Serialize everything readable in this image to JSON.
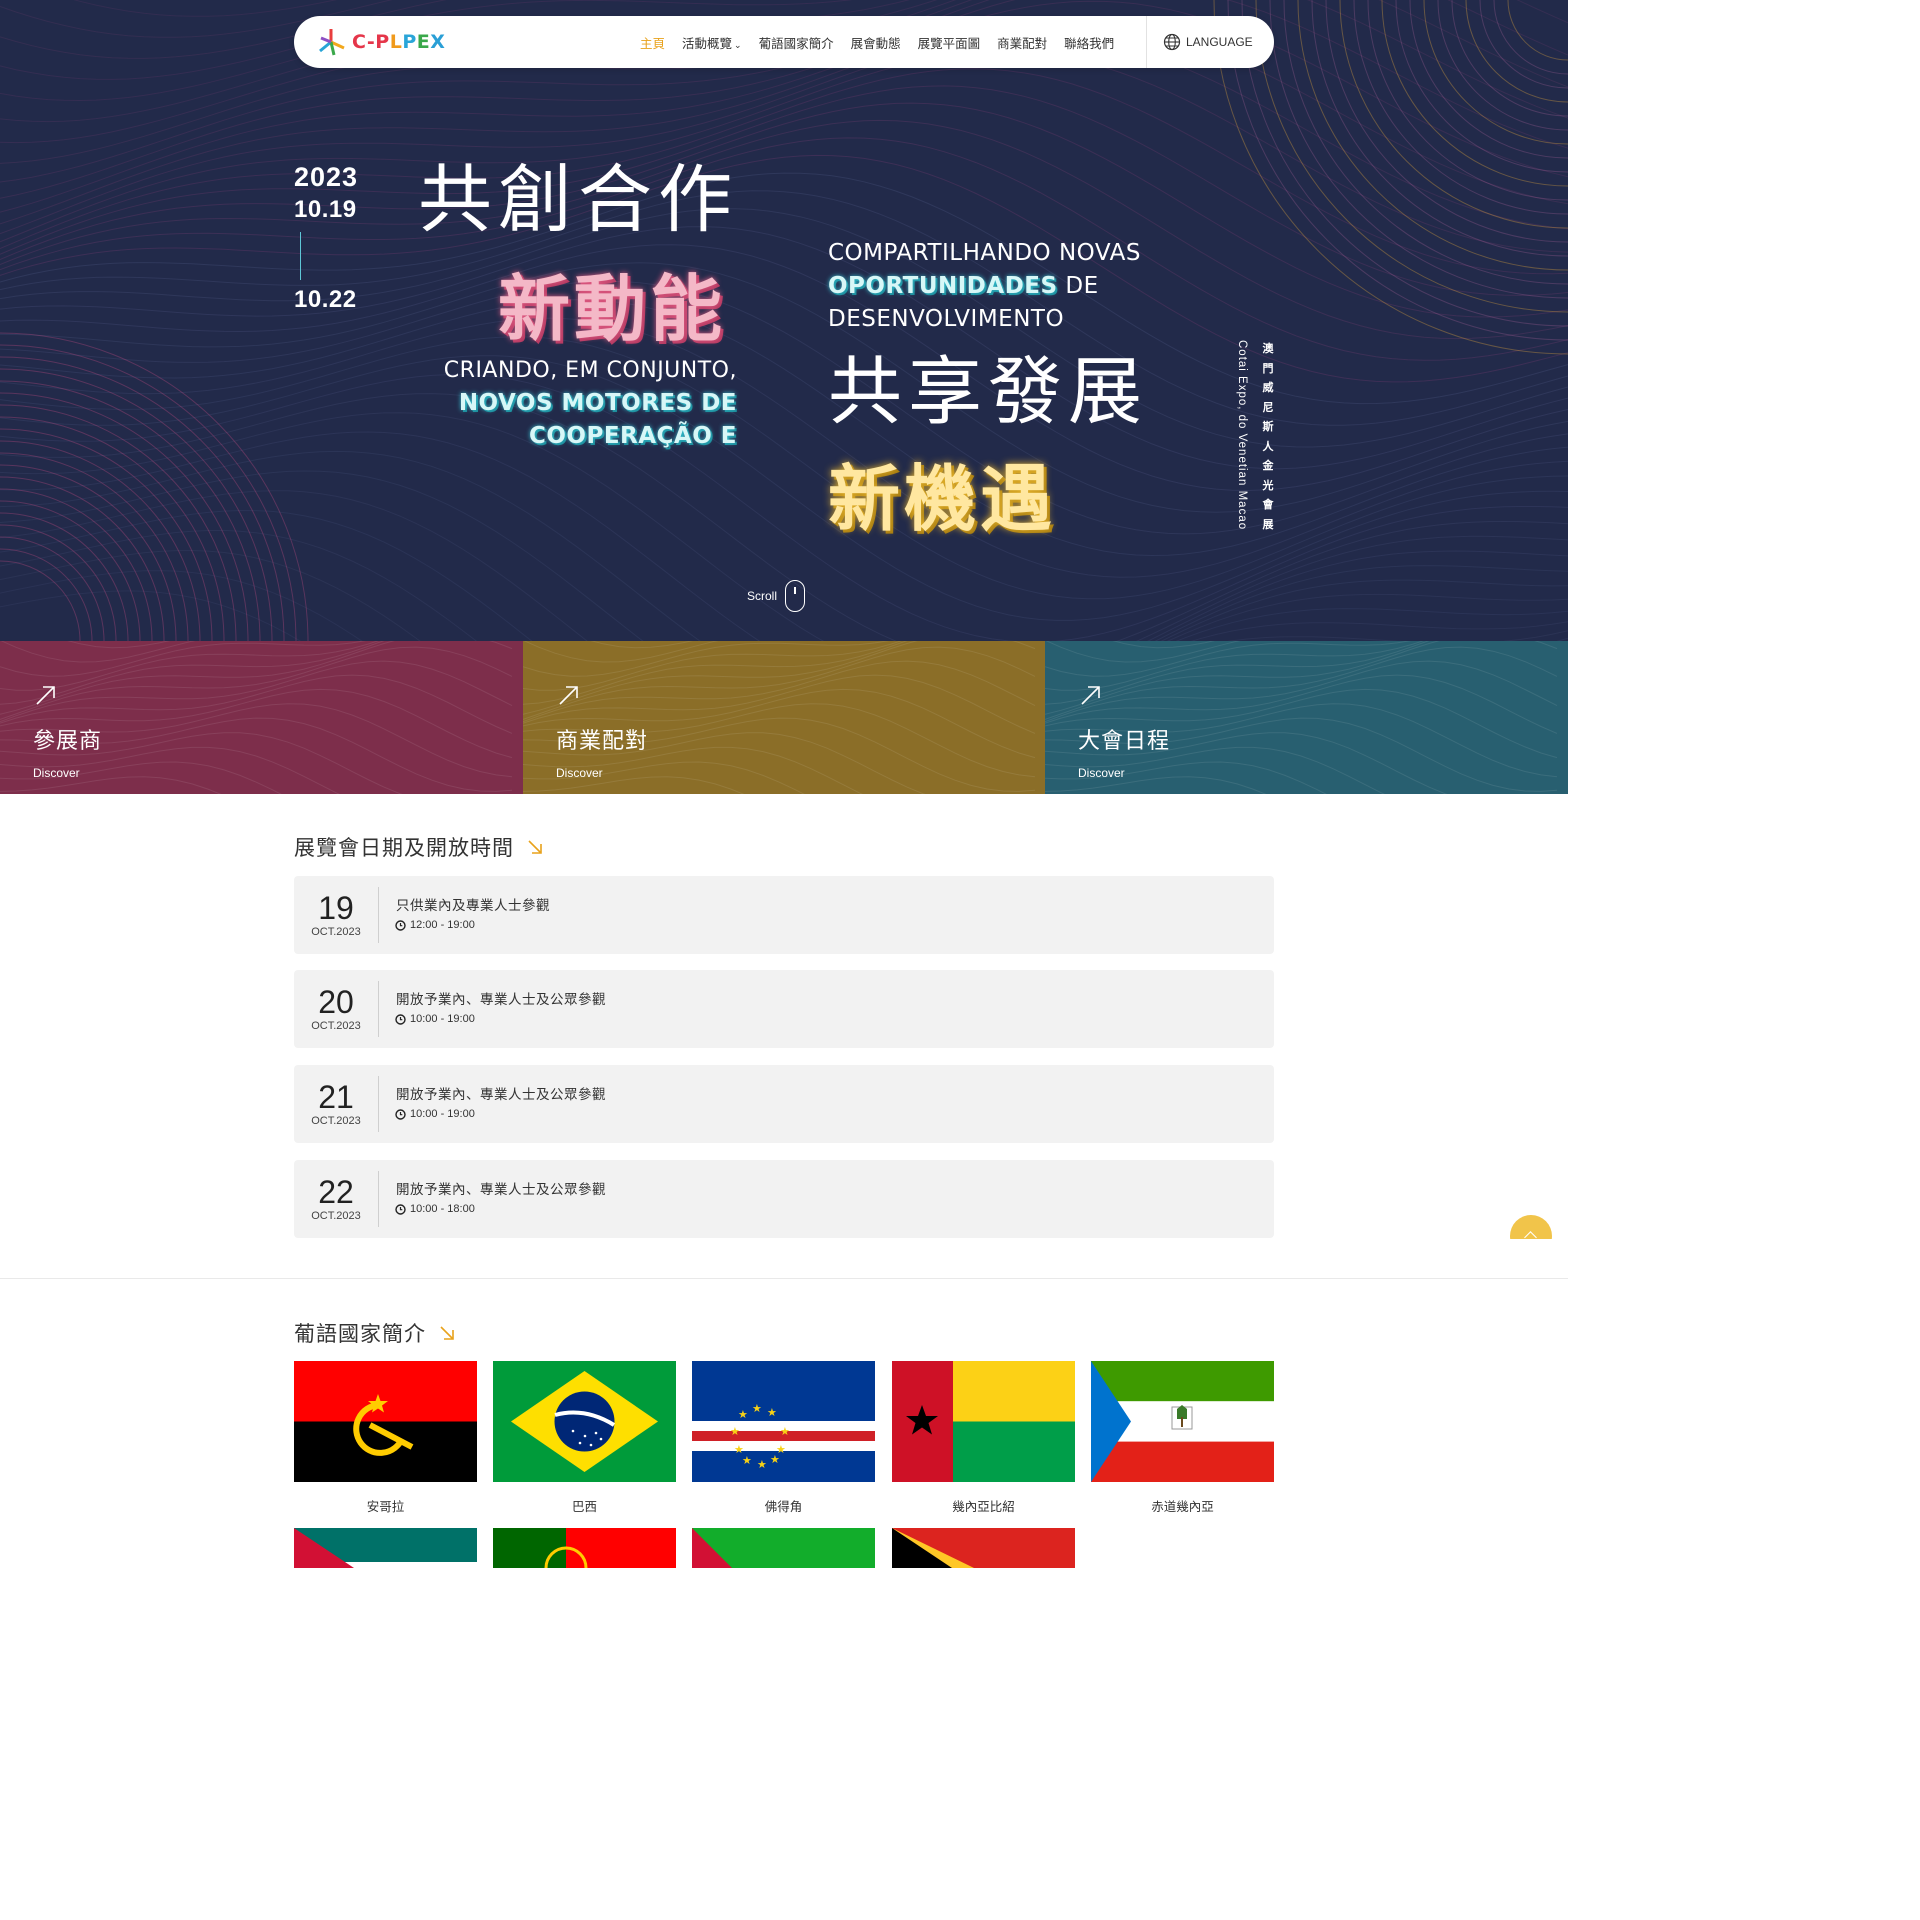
{
  "brand": {
    "logo_text": "C-PLPEX"
  },
  "nav": {
    "items": [
      "主頁",
      "活動概覽",
      "葡語國家簡介",
      "展會動態",
      "展覽平面圖",
      "商業配對",
      "聯絡我們"
    ],
    "language": "LANGUAGE",
    "colors": {
      "active": "#e8a21c",
      "hero_bg": "#222a4a"
    }
  },
  "hero": {
    "year": "2023",
    "date_start": "10.19",
    "date_end": "10.22",
    "cn_line1": "共創合作",
    "cn_line1_highlight": "新動能",
    "pt_left_line1": "CRIANDO, EM CONJUNTO,",
    "pt_left_line2": "NOVOS MOTORES DE",
    "pt_left_line3": "COOPERAÇÃO E",
    "pt_right_line1": "COMPARTILHANDO NOVAS",
    "pt_right_line2a": "OPORTUNIDADES",
    "pt_right_line2b": " DE",
    "pt_right_line3": "DESENVOLVIMENTO",
    "cn_line2": "共享發展",
    "cn_line2_highlight": "新機遇",
    "venue_cn": "澳門威尼斯人金光會展",
    "venue_en": "Cotai Expo, do Venetian Macao",
    "scroll_label": "Scroll"
  },
  "tiles": [
    {
      "title": "參展商",
      "link": "Discover",
      "color": "#7d2e4b"
    },
    {
      "title": "商業配對",
      "link": "Discover",
      "color": "#8b6e28"
    },
    {
      "title": "大會日程",
      "link": "Discover",
      "color": "#285f70"
    }
  ],
  "schedule": {
    "title": "展覽會日期及開放時間",
    "rows": [
      {
        "day": "19",
        "month": "OCT.2023",
        "desc": "只供業內及專業人士參觀",
        "time": "12:00 - 19:00"
      },
      {
        "day": "20",
        "month": "OCT.2023",
        "desc": "開放予業內、專業人士及公眾參觀",
        "time": "10:00 - 19:00"
      },
      {
        "day": "21",
        "month": "OCT.2023",
        "desc": "開放予業內、專業人士及公眾參觀",
        "time": "10:00 - 19:00"
      },
      {
        "day": "22",
        "month": "OCT.2023",
        "desc": "開放予業內、專業人士及公眾參觀",
        "time": "10:00 - 18:00"
      }
    ]
  },
  "countries": {
    "title": "葡語國家簡介",
    "items": [
      "安哥拉",
      "巴西",
      "佛得角",
      "幾內亞比紹",
      "赤道幾內亞"
    ]
  }
}
